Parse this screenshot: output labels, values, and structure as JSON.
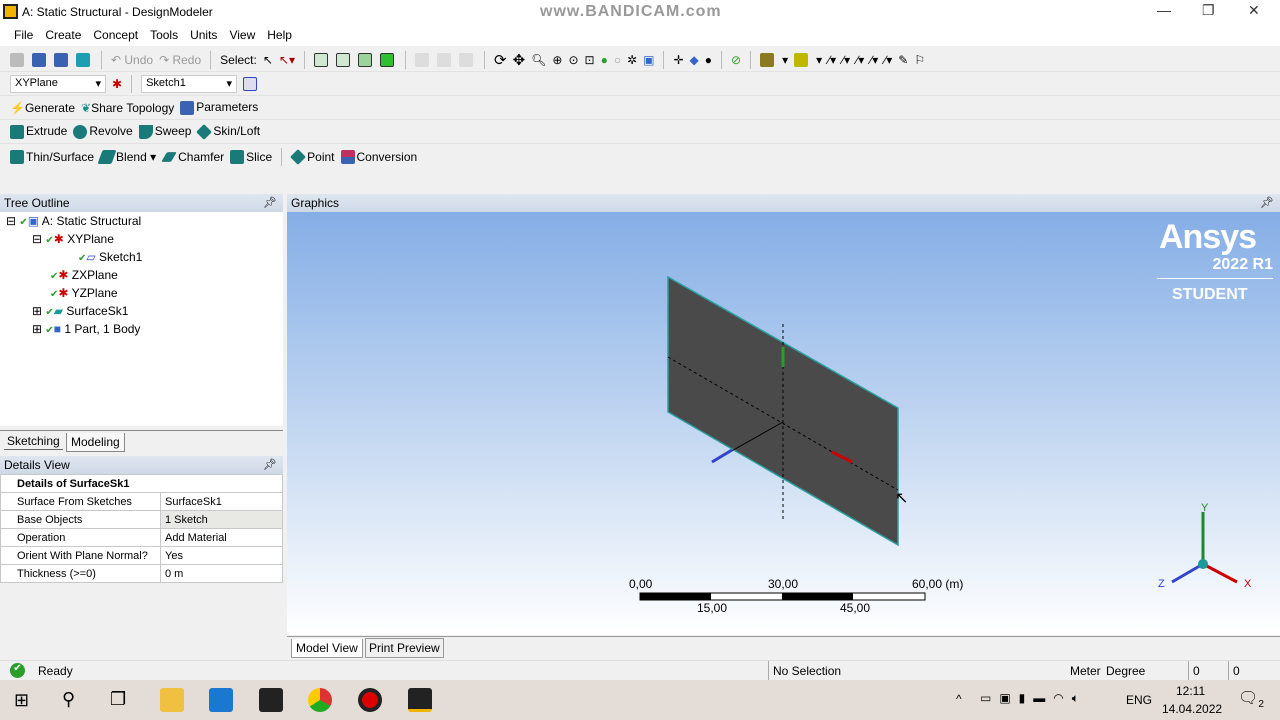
{
  "window": {
    "title": "A: Static Structural - DesignModeler",
    "watermark": "www.BANDICAM.com"
  },
  "menu": [
    "File",
    "Create",
    "Concept",
    "Tools",
    "Units",
    "View",
    "Help"
  ],
  "toolbar1": {
    "undo": "Undo",
    "redo": "Redo",
    "select": "Select:"
  },
  "toolbar2": {
    "plane": "XYPlane",
    "sketch": "Sketch1"
  },
  "toolbar3": {
    "generate": "Generate",
    "share_topology": "Share Topology",
    "parameters": "Parameters"
  },
  "toolbar4": {
    "extrude": "Extrude",
    "revolve": "Revolve",
    "sweep": "Sweep",
    "skin_loft": "Skin/Loft"
  },
  "toolbar5": {
    "thin_surface": "Thin/Surface",
    "blend": "Blend",
    "chamfer": "Chamfer",
    "slice": "Slice",
    "point": "Point",
    "conversion": "Conversion"
  },
  "tree": {
    "title": "Tree Outline",
    "items": [
      "A: Static Structural",
      "XYPlane",
      "Sketch1",
      "ZXPlane",
      "YZPlane",
      "SurfaceSk1",
      "1 Part, 1 Body"
    ]
  },
  "tabs": {
    "sketching": "Sketching",
    "modeling": "Modeling"
  },
  "details": {
    "title": "Details View",
    "header": "Details of SurfaceSk1",
    "rows": [
      {
        "k": "Surface From Sketches",
        "v": "SurfaceSk1"
      },
      {
        "k": "Base Objects",
        "v": "1 Sketch"
      },
      {
        "k": "Operation",
        "v": "Add Material"
      },
      {
        "k": "Orient With Plane Normal?",
        "v": "Yes"
      },
      {
        "k": "Thickness (>=0)",
        "v": "0 m"
      }
    ]
  },
  "graphics": {
    "title": "Graphics",
    "logo": "Ansys",
    "version": "2022 R1",
    "edition": "STUDENT",
    "scale": {
      "top": [
        "0,00",
        "30,00",
        "60,00 (m)"
      ],
      "bottom": [
        "15,00",
        "45,00"
      ]
    },
    "axes": {
      "x": "X",
      "y": "Y",
      "z": "Z"
    }
  },
  "view_tabs": {
    "model": "Model View",
    "print": "Print Preview"
  },
  "status": {
    "state": "Ready",
    "selection": "No Selection",
    "units_len": "Meter",
    "units_ang": "Degree",
    "v1": "0",
    "v2": "0"
  },
  "taskbar": {
    "lang": "ENG",
    "time": "12:11",
    "date": "14.04.2022",
    "notif": "2"
  }
}
